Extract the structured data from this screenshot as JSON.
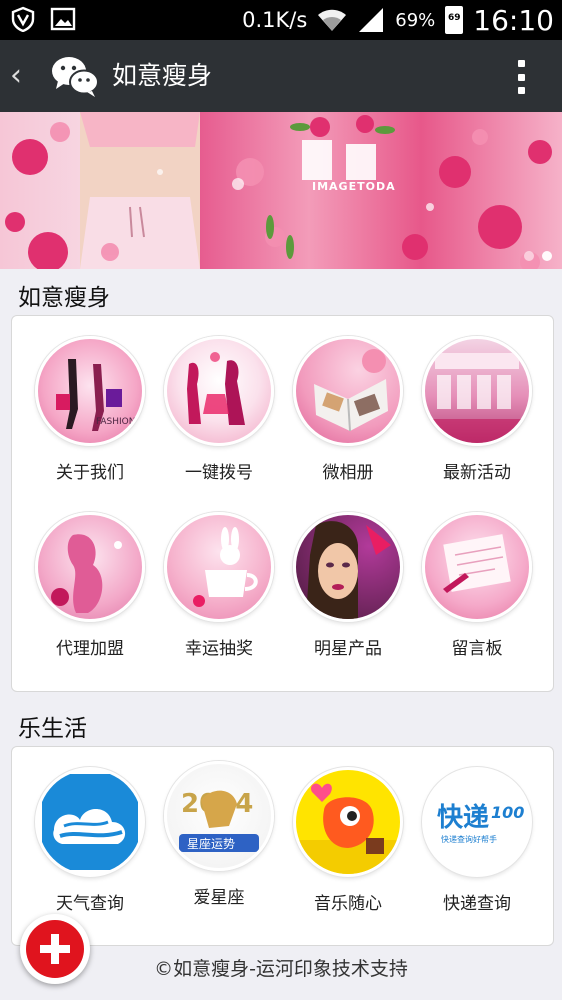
{
  "status_bar": {
    "network_speed": "0.1K/s",
    "battery_percent": "69%",
    "battery_level": "69",
    "time": "16:10",
    "icons": [
      "shield-icon",
      "image-icon",
      "wifi-icon",
      "signal-icon",
      "battery-icon"
    ]
  },
  "titlebar": {
    "back_glyph": "‹",
    "title": "如意瘦身"
  },
  "banner": {
    "text": "IMAGETODA",
    "slide_count": 2,
    "active_slide": 2
  },
  "sections": {
    "main_title": "如意瘦身",
    "life_title": "乐生活"
  },
  "main_grid": [
    {
      "label": "关于我们",
      "icon": "fashion-shopping-image"
    },
    {
      "label": "一键拨号",
      "icon": "fashion-silhouette-image"
    },
    {
      "label": "微相册",
      "icon": "photo-album-image"
    },
    {
      "label": "最新活动",
      "icon": "event-hall-image"
    },
    {
      "label": "代理加盟",
      "icon": "lady-silhouette-image"
    },
    {
      "label": "幸运抽奖",
      "icon": "rabbit-cup-image"
    },
    {
      "label": "明星产品",
      "icon": "model-face-image"
    },
    {
      "label": "留言板",
      "icon": "message-note-image"
    }
  ],
  "life_grid": [
    {
      "label": "天气查询",
      "icon": "weather-cloud-icon"
    },
    {
      "label": "爱星座",
      "icon": "horoscope-horse-icon",
      "badge": "星座运势",
      "year": "2014"
    },
    {
      "label": "音乐随心",
      "icon": "music-monster-icon"
    },
    {
      "label": "快递查询",
      "icon": "express-100-icon",
      "logo_text": "快递",
      "logo_num": "100",
      "slogan": "快递查询好帮手"
    }
  ],
  "footer": "©如意瘦身-运河印象技术支持",
  "colors": {
    "titlebar": "#2d3135",
    "accent_pink": "#e65a8e",
    "fab_red": "#e0141e",
    "page_bg": "#efeff4"
  }
}
